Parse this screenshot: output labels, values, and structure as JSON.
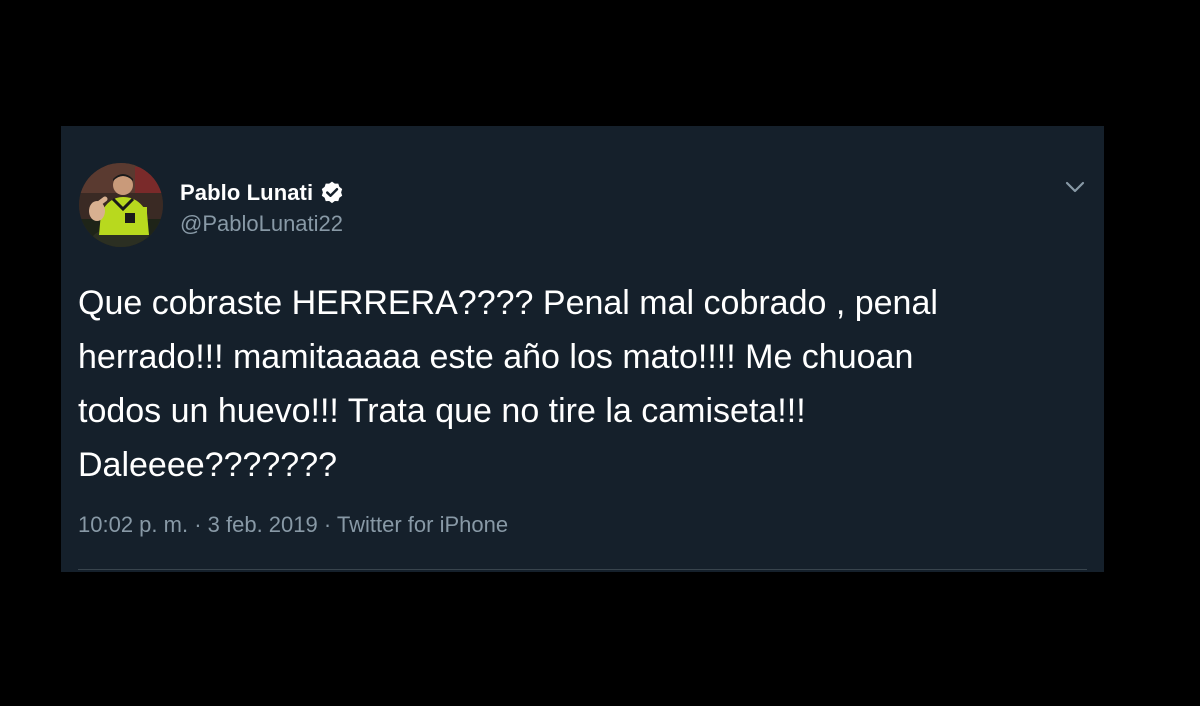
{
  "tweet": {
    "author": {
      "display_name": "Pablo Lunati",
      "handle": "@PabloLunati22",
      "avatar_icon": "referee-photo-avatar",
      "verified": true,
      "verified_icon": "verified-badge-icon"
    },
    "text": "Que cobraste HERRERA???? Penal mal cobrado , penal\nherrado!!! mamitaaaaa este año los mato!!!! Me chuoan\ntodos un huevo!!! Trata que no tire la camiseta!!!\nDaleeee???????",
    "time": "10:02 p. m.",
    "separator1": " · ",
    "date": "3 feb. 2019",
    "separator2": " · ",
    "source": "Twitter for iPhone",
    "menu_icon": "chevron-down-icon"
  },
  "colors": {
    "page_background": "#000000",
    "card_background": "#15202b",
    "primary_text": "#ffffff",
    "secondary_text": "#8899a6",
    "divider": "#38444d"
  }
}
